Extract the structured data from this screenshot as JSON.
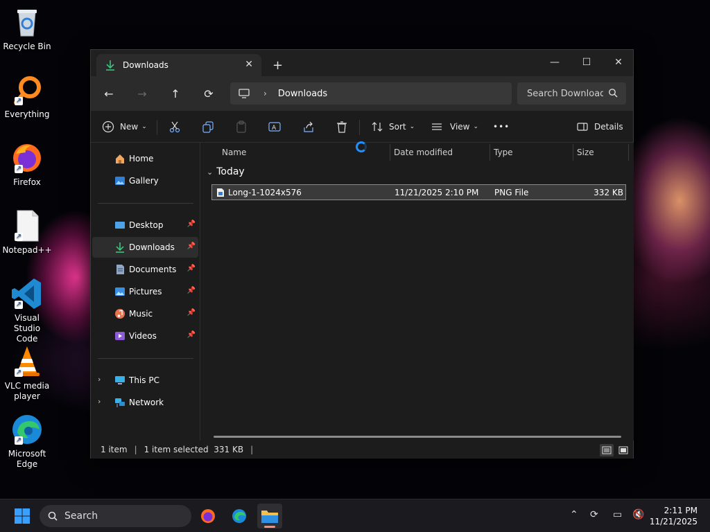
{
  "desktop": {
    "icons": [
      {
        "label": "Recycle Bin"
      },
      {
        "label": "Everything"
      },
      {
        "label": "Firefox"
      },
      {
        "label": "Notepad++"
      },
      {
        "label": "Visual Studio Code"
      },
      {
        "label": "VLC media player"
      },
      {
        "label": "Microsoft Edge"
      }
    ]
  },
  "window": {
    "tab": {
      "title": "Downloads",
      "icon": "download-icon"
    },
    "controls": {
      "minimize": "—",
      "maximize": "☐",
      "close": "✕"
    },
    "address": {
      "location": "Downloads"
    },
    "search": {
      "placeholder": "Search Downloads"
    },
    "toolbar": {
      "new_label": "New",
      "sort_label": "Sort",
      "view_label": "View",
      "more_label": "•••",
      "details_label": "Details"
    },
    "sidebar": {
      "top": [
        {
          "label": "Home"
        },
        {
          "label": "Gallery"
        }
      ],
      "pinned": [
        {
          "label": "Desktop"
        },
        {
          "label": "Downloads"
        },
        {
          "label": "Documents"
        },
        {
          "label": "Pictures"
        },
        {
          "label": "Music"
        },
        {
          "label": "Videos"
        }
      ],
      "bottom": [
        {
          "label": "This PC"
        },
        {
          "label": "Network"
        }
      ]
    },
    "columns": [
      "Name",
      "Date modified",
      "Type",
      "Size"
    ],
    "group_label": "Today",
    "files": [
      {
        "name": "Long-1-1024x576",
        "date": "11/21/2025 2:10 PM",
        "type": "PNG File",
        "size": "332 KB"
      }
    ],
    "status": {
      "count": "1 item",
      "selected": "1 item selected  331 KB"
    }
  },
  "taskbar": {
    "search_label": "Search",
    "time": "2:11 PM",
    "date": "11/21/2025"
  },
  "colors": {
    "accent": "#1e90ff",
    "download_green": "#3cc47c",
    "folder_yellow": "#f2c04b"
  }
}
